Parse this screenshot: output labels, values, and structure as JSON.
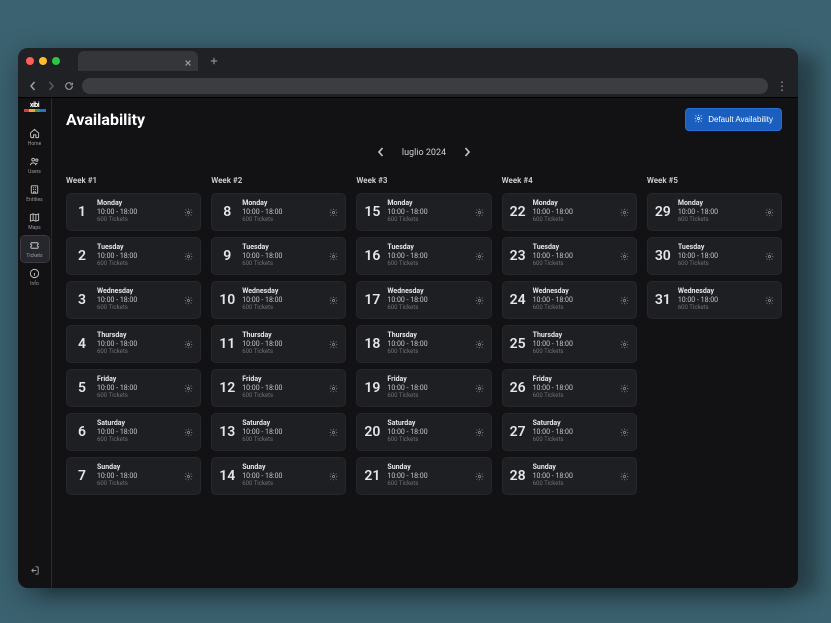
{
  "page": {
    "title": "Availability"
  },
  "actions": {
    "default_availability": "Default Availability"
  },
  "month": {
    "label": "luglio 2024"
  },
  "sidebar": {
    "logo": "xibi",
    "items": [
      {
        "label": "Home"
      },
      {
        "label": "Users"
      },
      {
        "label": "Entities"
      },
      {
        "label": "Maps"
      },
      {
        "label": "Tickets"
      },
      {
        "label": "Info"
      }
    ]
  },
  "weeks": [
    {
      "label": "Week #1",
      "days": [
        {
          "num": "1",
          "name": "Monday",
          "time": "10:00 - 18:00",
          "tickets": "600 Tickets"
        },
        {
          "num": "2",
          "name": "Tuesday",
          "time": "10:00 - 18:00",
          "tickets": "600 Tickets"
        },
        {
          "num": "3",
          "name": "Wednesday",
          "time": "10:00 - 18:00",
          "tickets": "600 Tickets"
        },
        {
          "num": "4",
          "name": "Thursday",
          "time": "10:00 - 18:00",
          "tickets": "600 Tickets"
        },
        {
          "num": "5",
          "name": "Friday",
          "time": "10:00 - 18:00",
          "tickets": "600 Tickets"
        },
        {
          "num": "6",
          "name": "Saturday",
          "time": "10:00 - 18:00",
          "tickets": "600 Tickets"
        },
        {
          "num": "7",
          "name": "Sunday",
          "time": "10:00 - 18:00",
          "tickets": "600 Tickets"
        }
      ]
    },
    {
      "label": "Week #2",
      "days": [
        {
          "num": "8",
          "name": "Monday",
          "time": "10:00 - 18:00",
          "tickets": "600 Tickets"
        },
        {
          "num": "9",
          "name": "Tuesday",
          "time": "10:00 - 18:00",
          "tickets": "600 Tickets"
        },
        {
          "num": "10",
          "name": "Wednesday",
          "time": "10:00 - 18:00",
          "tickets": "600 Tickets"
        },
        {
          "num": "11",
          "name": "Thursday",
          "time": "10:00 - 18:00",
          "tickets": "600 Tickets"
        },
        {
          "num": "12",
          "name": "Friday",
          "time": "10:00 - 18:00",
          "tickets": "600 Tickets"
        },
        {
          "num": "13",
          "name": "Saturday",
          "time": "10:00 - 18:00",
          "tickets": "600 Tickets"
        },
        {
          "num": "14",
          "name": "Sunday",
          "time": "10:00 - 18:00",
          "tickets": "600 Tickets"
        }
      ]
    },
    {
      "label": "Week #3",
      "days": [
        {
          "num": "15",
          "name": "Monday",
          "time": "10:00 - 18:00",
          "tickets": "600 Tickets"
        },
        {
          "num": "16",
          "name": "Tuesday",
          "time": "10:00 - 18:00",
          "tickets": "600 Tickets"
        },
        {
          "num": "17",
          "name": "Wednesday",
          "time": "10:00 - 18:00",
          "tickets": "600 Tickets"
        },
        {
          "num": "18",
          "name": "Thursday",
          "time": "10:00 - 18:00",
          "tickets": "600 Tickets"
        },
        {
          "num": "19",
          "name": "Friday",
          "time": "10:00 - 18:00",
          "tickets": "600 Tickets"
        },
        {
          "num": "20",
          "name": "Saturday",
          "time": "10:00 - 18:00",
          "tickets": "600 Tickets"
        },
        {
          "num": "21",
          "name": "Sunday",
          "time": "10:00 - 18:00",
          "tickets": "600 Tickets"
        }
      ]
    },
    {
      "label": "Week #4",
      "days": [
        {
          "num": "22",
          "name": "Monday",
          "time": "10:00 - 18:00",
          "tickets": "600 Tickets"
        },
        {
          "num": "23",
          "name": "Tuesday",
          "time": "10:00 - 18:00",
          "tickets": "600 Tickets"
        },
        {
          "num": "24",
          "name": "Wednesday",
          "time": "10:00 - 18:00",
          "tickets": "600 Tickets"
        },
        {
          "num": "25",
          "name": "Thursday",
          "time": "10:00 - 18:00",
          "tickets": "600 Tickets"
        },
        {
          "num": "26",
          "name": "Friday",
          "time": "10:00 - 18:00",
          "tickets": "600 Tickets"
        },
        {
          "num": "27",
          "name": "Saturday",
          "time": "10:00 - 18:00",
          "tickets": "600 Tickets"
        },
        {
          "num": "28",
          "name": "Sunday",
          "time": "10:00 - 18:00",
          "tickets": "600 Tickets"
        }
      ]
    },
    {
      "label": "Week #5",
      "days": [
        {
          "num": "29",
          "name": "Monday",
          "time": "10:00 - 18:00",
          "tickets": "600 Tickets"
        },
        {
          "num": "30",
          "name": "Tuesday",
          "time": "10:00 - 18:00",
          "tickets": "600 Tickets"
        },
        {
          "num": "31",
          "name": "Wednesday",
          "time": "10:00 - 18:00",
          "tickets": "600 Tickets"
        }
      ]
    }
  ]
}
